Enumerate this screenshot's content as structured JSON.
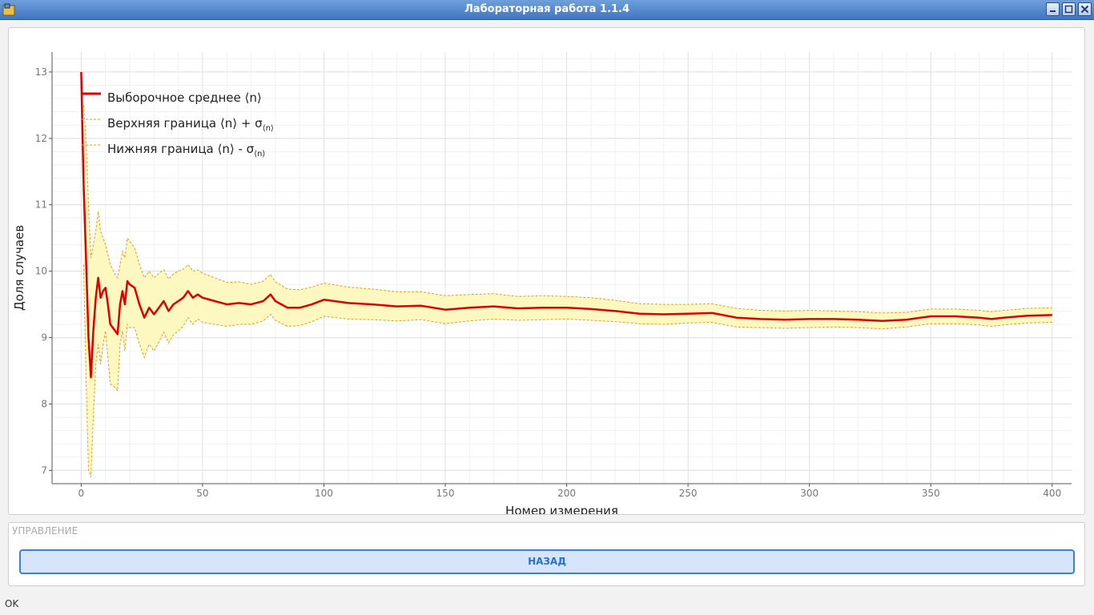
{
  "window": {
    "title": "Лабораторная работа 1.1.4",
    "colors": {
      "titlebar": "#3f76c2",
      "titlebar_text": "#ffffff"
    }
  },
  "legend": {
    "mean": "Выборочное среднее ⟨n⟩",
    "upper_main": "Верхняя граница ⟨n⟩ + σ",
    "upper_sub": "⟨n⟩",
    "lower_main": "Нижняя граница ⟨n⟩ - σ",
    "lower_sub": "⟨n⟩"
  },
  "chart_data": {
    "type": "line",
    "xlabel": "Номер измерения",
    "ylabel": "Доля случаев",
    "xlim": [
      -12,
      408
    ],
    "ylim": [
      6.8,
      13.3
    ],
    "x_ticks": [
      0,
      50,
      100,
      150,
      200,
      250,
      300,
      350,
      400
    ],
    "y_ticks": [
      7,
      8,
      9,
      10,
      11,
      12,
      13
    ],
    "grid": true,
    "legend_position": "top-left",
    "colors": {
      "mean": "#dd0000",
      "bounds": "#e0a020",
      "band_fill": "#fdf8c0"
    },
    "series": [
      {
        "name": "Выборочное среднее ⟨n⟩",
        "points": [
          [
            0,
            13.0
          ],
          [
            1,
            11.3
          ],
          [
            2,
            10.2
          ],
          [
            3,
            9.0
          ],
          [
            4,
            8.4
          ],
          [
            5,
            9.1
          ],
          [
            6,
            9.6
          ],
          [
            7,
            9.9
          ],
          [
            8,
            9.6
          ],
          [
            9,
            9.7
          ],
          [
            10,
            9.75
          ],
          [
            11,
            9.5
          ],
          [
            12,
            9.2
          ],
          [
            14,
            9.1
          ],
          [
            15,
            9.05
          ],
          [
            16,
            9.5
          ],
          [
            17,
            9.7
          ],
          [
            18,
            9.5
          ],
          [
            19,
            9.85
          ],
          [
            20,
            9.8
          ],
          [
            22,
            9.75
          ],
          [
            24,
            9.5
          ],
          [
            26,
            9.3
          ],
          [
            28,
            9.45
          ],
          [
            30,
            9.35
          ],
          [
            32,
            9.45
          ],
          [
            34,
            9.55
          ],
          [
            36,
            9.4
          ],
          [
            38,
            9.5
          ],
          [
            40,
            9.55
          ],
          [
            42,
            9.6
          ],
          [
            44,
            9.7
          ],
          [
            46,
            9.6
          ],
          [
            48,
            9.65
          ],
          [
            50,
            9.6
          ],
          [
            55,
            9.55
          ],
          [
            60,
            9.5
          ],
          [
            65,
            9.52
          ],
          [
            70,
            9.5
          ],
          [
            75,
            9.55
          ],
          [
            78,
            9.65
          ],
          [
            80,
            9.55
          ],
          [
            85,
            9.45
          ],
          [
            90,
            9.45
          ],
          [
            95,
            9.5
          ],
          [
            100,
            9.57
          ],
          [
            110,
            9.52
          ],
          [
            120,
            9.5
          ],
          [
            130,
            9.47
          ],
          [
            140,
            9.48
          ],
          [
            150,
            9.42
          ],
          [
            160,
            9.45
          ],
          [
            170,
            9.47
          ],
          [
            180,
            9.44
          ],
          [
            190,
            9.45
          ],
          [
            200,
            9.45
          ],
          [
            210,
            9.43
          ],
          [
            220,
            9.4
          ],
          [
            230,
            9.36
          ],
          [
            240,
            9.35
          ],
          [
            250,
            9.36
          ],
          [
            260,
            9.37
          ],
          [
            270,
            9.3
          ],
          [
            280,
            9.28
          ],
          [
            290,
            9.27
          ],
          [
            300,
            9.28
          ],
          [
            310,
            9.28
          ],
          [
            320,
            9.27
          ],
          [
            330,
            9.25
          ],
          [
            340,
            9.27
          ],
          [
            350,
            9.32
          ],
          [
            360,
            9.32
          ],
          [
            370,
            9.3
          ],
          [
            375,
            9.28
          ],
          [
            380,
            9.3
          ],
          [
            390,
            9.33
          ],
          [
            400,
            9.34
          ]
        ]
      },
      {
        "name": "Верхняя граница ⟨n⟩ + σ⟨n⟩",
        "points": [
          [
            1,
            12.5
          ],
          [
            2,
            12.0
          ],
          [
            3,
            11.0
          ],
          [
            4,
            10.2
          ],
          [
            5,
            10.4
          ],
          [
            6,
            10.6
          ],
          [
            7,
            10.9
          ],
          [
            8,
            10.6
          ],
          [
            9,
            10.5
          ],
          [
            10,
            10.4
          ],
          [
            12,
            10.1
          ],
          [
            14,
            9.95
          ],
          [
            15,
            9.9
          ],
          [
            16,
            10.1
          ],
          [
            17,
            10.3
          ],
          [
            18,
            10.2
          ],
          [
            19,
            10.5
          ],
          [
            20,
            10.45
          ],
          [
            22,
            10.35
          ],
          [
            24,
            10.1
          ],
          [
            26,
            9.9
          ],
          [
            28,
            10.0
          ],
          [
            30,
            9.9
          ],
          [
            32,
            9.97
          ],
          [
            34,
            10.02
          ],
          [
            36,
            9.88
          ],
          [
            38,
            9.96
          ],
          [
            40,
            10.0
          ],
          [
            42,
            10.03
          ],
          [
            44,
            10.1
          ],
          [
            46,
            10.0
          ],
          [
            48,
            10.02
          ],
          [
            50,
            9.97
          ],
          [
            55,
            9.9
          ],
          [
            60,
            9.83
          ],
          [
            65,
            9.84
          ],
          [
            70,
            9.8
          ],
          [
            75,
            9.85
          ],
          [
            78,
            9.95
          ],
          [
            80,
            9.84
          ],
          [
            85,
            9.73
          ],
          [
            90,
            9.72
          ],
          [
            95,
            9.76
          ],
          [
            100,
            9.82
          ],
          [
            110,
            9.76
          ],
          [
            120,
            9.73
          ],
          [
            130,
            9.69
          ],
          [
            140,
            9.69
          ],
          [
            150,
            9.63
          ],
          [
            160,
            9.65
          ],
          [
            170,
            9.66
          ],
          [
            180,
            9.62
          ],
          [
            190,
            9.63
          ],
          [
            200,
            9.62
          ],
          [
            210,
            9.6
          ],
          [
            220,
            9.56
          ],
          [
            230,
            9.51
          ],
          [
            240,
            9.5
          ],
          [
            250,
            9.5
          ],
          [
            260,
            9.51
          ],
          [
            270,
            9.44
          ],
          [
            280,
            9.41
          ],
          [
            290,
            9.4
          ],
          [
            300,
            9.41
          ],
          [
            310,
            9.4
          ],
          [
            320,
            9.39
          ],
          [
            330,
            9.37
          ],
          [
            340,
            9.38
          ],
          [
            350,
            9.43
          ],
          [
            360,
            9.43
          ],
          [
            370,
            9.41
          ],
          [
            375,
            9.39
          ],
          [
            380,
            9.41
          ],
          [
            390,
            9.44
          ],
          [
            400,
            9.45
          ]
        ]
      },
      {
        "name": "Нижняя граница ⟨n⟩ - σ⟨n⟩",
        "points": [
          [
            1,
            10.1
          ],
          [
            2,
            8.4
          ],
          [
            3,
            7.0
          ],
          [
            4,
            6.9
          ],
          [
            5,
            7.8
          ],
          [
            6,
            8.6
          ],
          [
            7,
            8.9
          ],
          [
            8,
            8.6
          ],
          [
            9,
            8.9
          ],
          [
            10,
            9.1
          ],
          [
            12,
            8.3
          ],
          [
            14,
            8.25
          ],
          [
            15,
            8.2
          ],
          [
            16,
            8.9
          ],
          [
            17,
            9.1
          ],
          [
            18,
            8.8
          ],
          [
            19,
            9.2
          ],
          [
            20,
            9.15
          ],
          [
            22,
            9.15
          ],
          [
            24,
            8.9
          ],
          [
            26,
            8.7
          ],
          [
            28,
            8.9
          ],
          [
            30,
            8.8
          ],
          [
            32,
            8.93
          ],
          [
            34,
            9.08
          ],
          [
            36,
            8.92
          ],
          [
            38,
            9.04
          ],
          [
            40,
            9.1
          ],
          [
            42,
            9.17
          ],
          [
            44,
            9.3
          ],
          [
            46,
            9.2
          ],
          [
            48,
            9.28
          ],
          [
            50,
            9.23
          ],
          [
            55,
            9.2
          ],
          [
            60,
            9.17
          ],
          [
            65,
            9.2
          ],
          [
            70,
            9.2
          ],
          [
            75,
            9.25
          ],
          [
            78,
            9.35
          ],
          [
            80,
            9.26
          ],
          [
            85,
            9.17
          ],
          [
            90,
            9.18
          ],
          [
            95,
            9.24
          ],
          [
            100,
            9.32
          ],
          [
            110,
            9.28
          ],
          [
            120,
            9.27
          ],
          [
            130,
            9.25
          ],
          [
            140,
            9.27
          ],
          [
            150,
            9.21
          ],
          [
            160,
            9.25
          ],
          [
            170,
            9.28
          ],
          [
            180,
            9.26
          ],
          [
            190,
            9.27
          ],
          [
            200,
            9.28
          ],
          [
            210,
            9.26
          ],
          [
            220,
            9.24
          ],
          [
            230,
            9.21
          ],
          [
            240,
            9.2
          ],
          [
            250,
            9.22
          ],
          [
            260,
            9.23
          ],
          [
            270,
            9.16
          ],
          [
            280,
            9.15
          ],
          [
            290,
            9.14
          ],
          [
            300,
            9.15
          ],
          [
            310,
            9.16
          ],
          [
            320,
            9.15
          ],
          [
            330,
            9.13
          ],
          [
            340,
            9.16
          ],
          [
            350,
            9.21
          ],
          [
            360,
            9.21
          ],
          [
            370,
            9.19
          ],
          [
            375,
            9.17
          ],
          [
            380,
            9.19
          ],
          [
            390,
            9.22
          ],
          [
            400,
            9.23
          ]
        ]
      }
    ]
  },
  "control": {
    "title": "УПРАВЛЕНИЕ",
    "back_label": "НАЗАД"
  },
  "status": {
    "text": "OK"
  }
}
